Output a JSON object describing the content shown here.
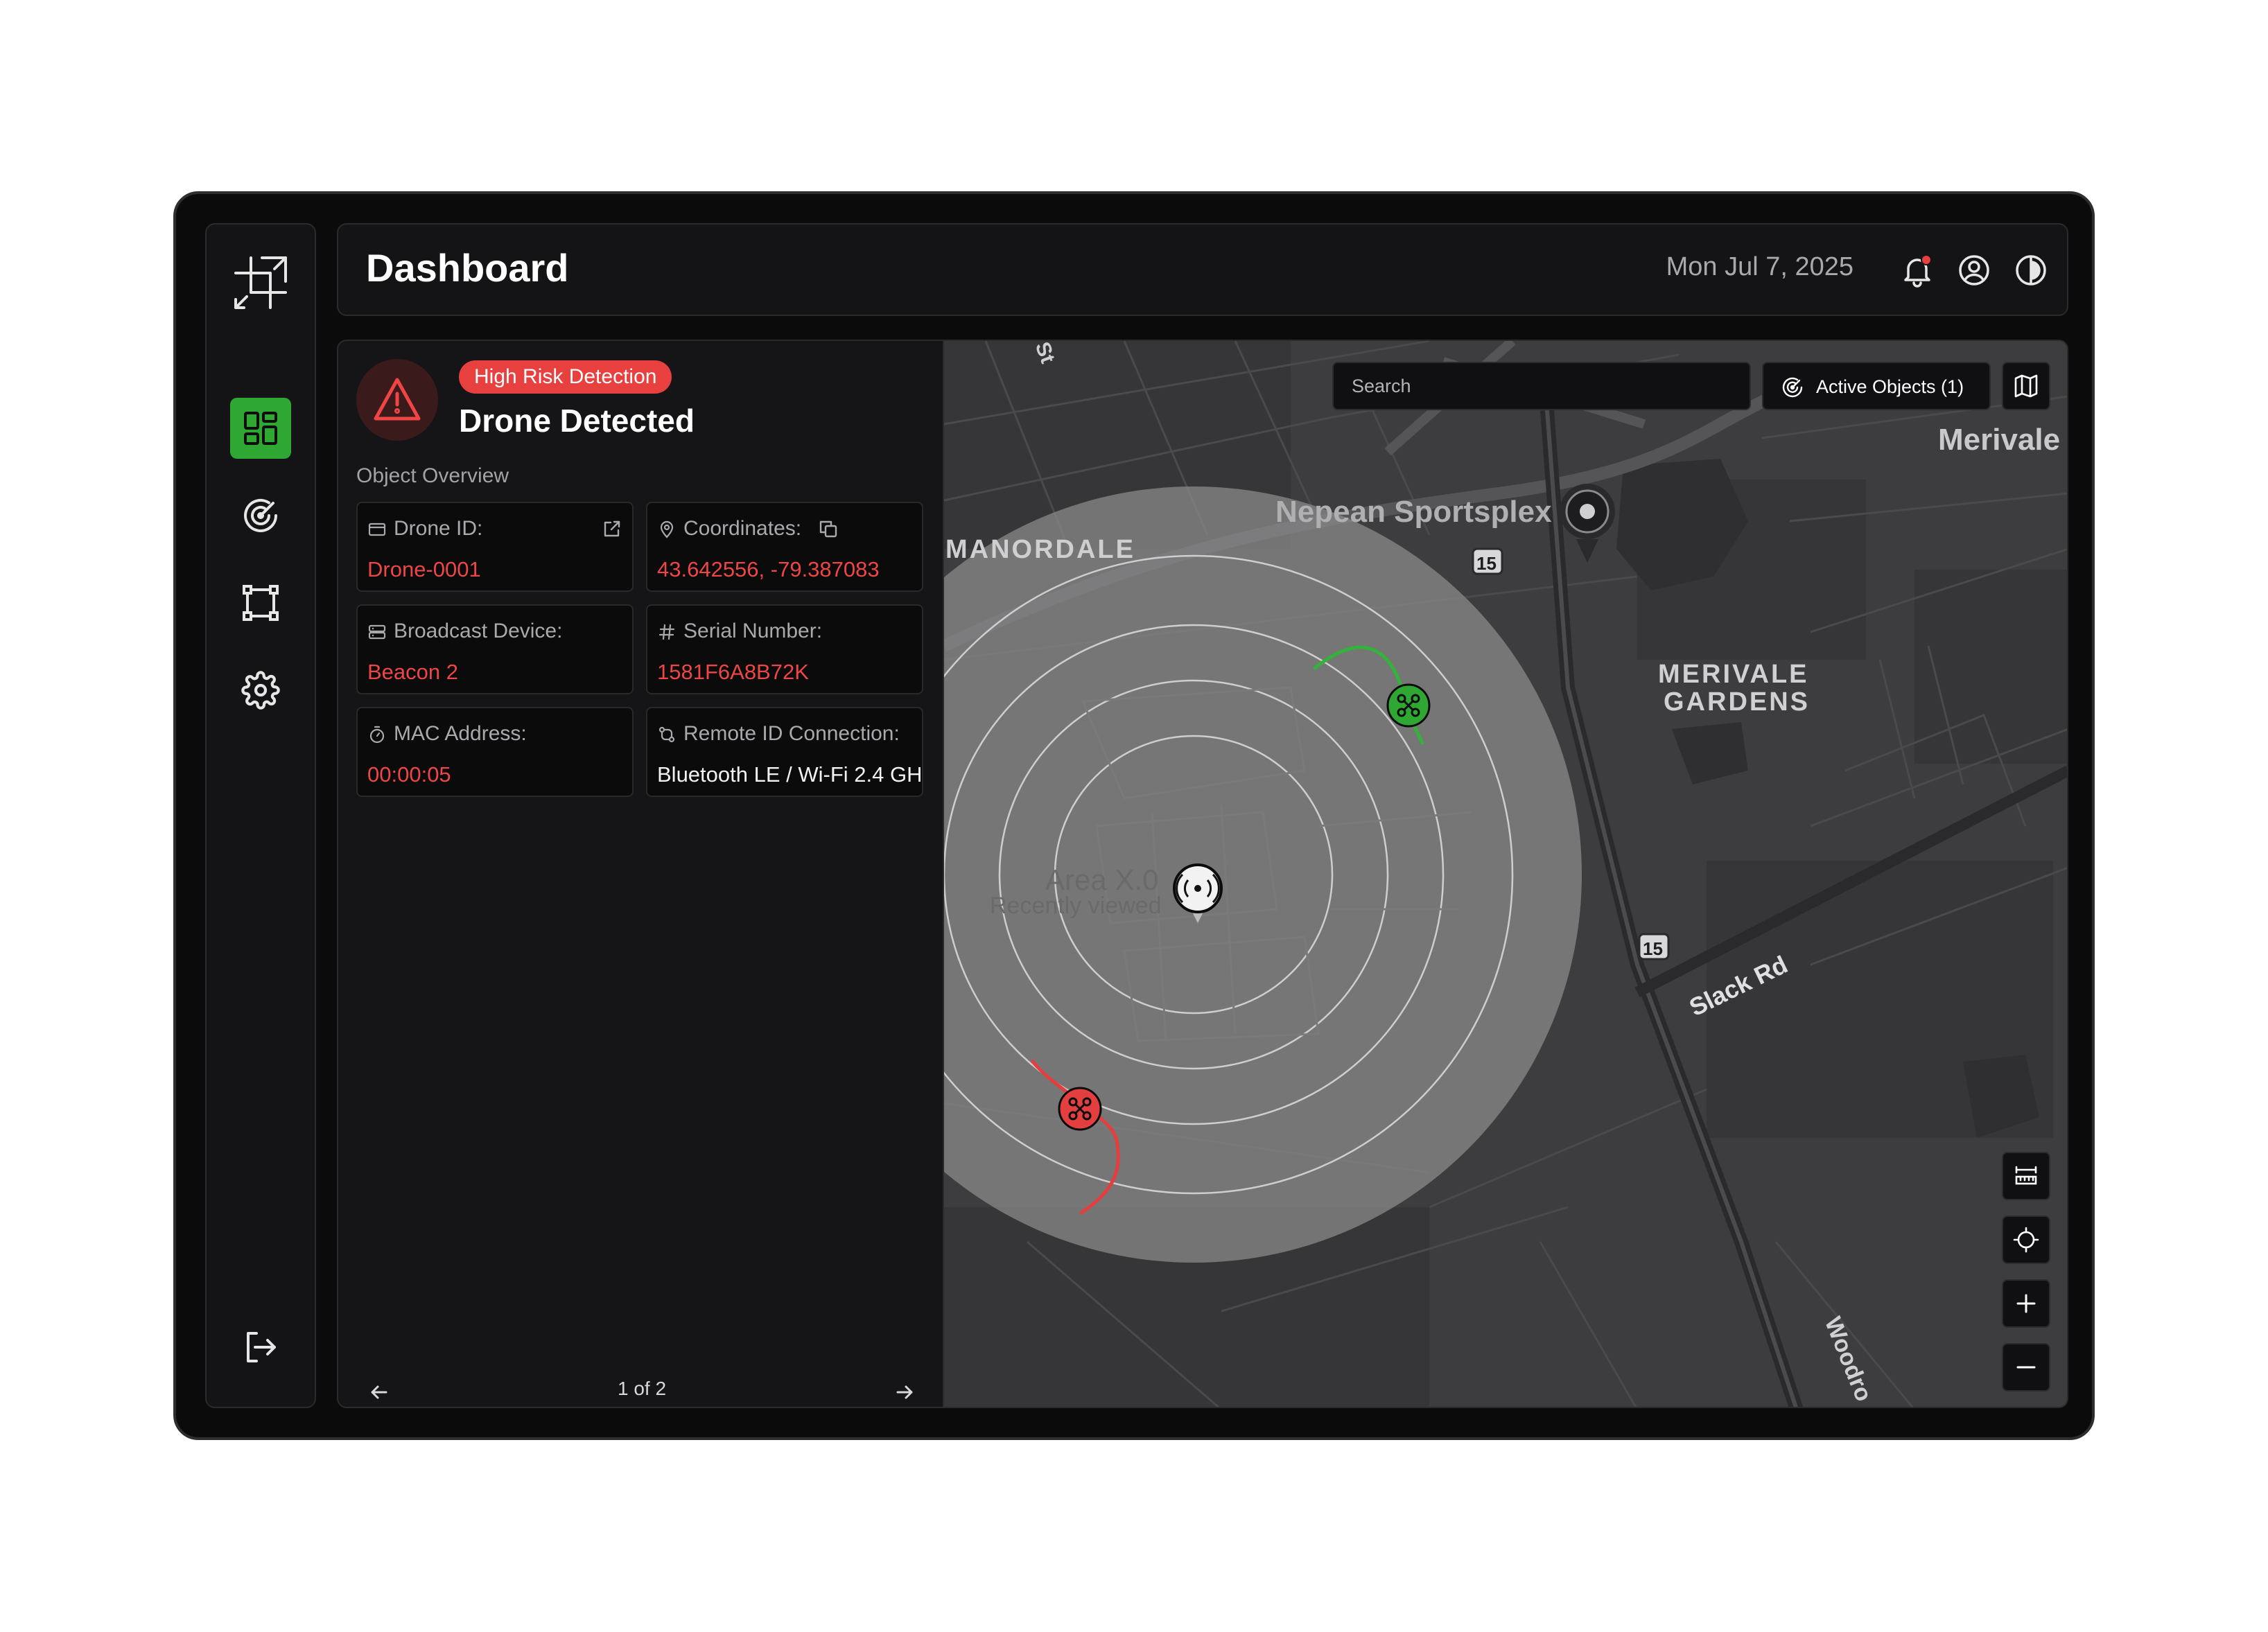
{
  "header": {
    "title": "Dashboard",
    "date": "Mon Jul 7, 2025"
  },
  "colors": {
    "accent_green": "#2fa833",
    "alert_red": "#e83f3f",
    "panel_bg": "#151517",
    "map_bg": "#3d3d3f"
  },
  "sidebar": {
    "logo_icon": "crop-logo-icon",
    "items": [
      {
        "icon": "dashboard-icon",
        "active": true
      },
      {
        "icon": "radar-icon",
        "active": false
      },
      {
        "icon": "bounding-box-icon",
        "active": false
      },
      {
        "icon": "gear-icon",
        "active": false
      }
    ],
    "logout_icon": "logout-icon"
  },
  "alert": {
    "badge": "High Risk Detection",
    "title": "Drone Detected",
    "section_label": "Object Overview",
    "fields": [
      {
        "label": "Drone ID:",
        "value": "Drone-0001",
        "icon": "id-card-icon",
        "action_icon": "external-link-icon"
      },
      {
        "label": "Coordinates:",
        "value": "43.642556, -79.387083",
        "icon": "location-pin-icon",
        "action_icon": "copy-icon"
      },
      {
        "label": "Broadcast Device:",
        "value": "Beacon 2",
        "icon": "server-icon"
      },
      {
        "label": "Serial Number:",
        "value": "1581F6A8B72K",
        "icon": "hash-icon"
      },
      {
        "label": "MAC Address:",
        "value": "00:00:05",
        "icon": "timer-icon"
      },
      {
        "label": "Remote ID Connection:",
        "value": "Bluetooth LE / Wi-Fi 2.4 GH",
        "icon": "connection-icon"
      }
    ],
    "pager": "1 of 2"
  },
  "map": {
    "search_placeholder": "Search",
    "active_objects_label": "Active Objects (1)",
    "labels": {
      "merivale_e": "Merivale E",
      "nepean": "Nepean Sportsplex",
      "manordale": "MANORDALE",
      "merivale_gardens_1": "MERIVALE",
      "merivale_gardens_2": "GARDENS",
      "area": "Area X.0",
      "recently_viewed": "Recently viewed",
      "slack_rd": "Slack Rd",
      "woodroffe": "Woodro",
      "route_1": "15",
      "route_2": "15",
      "street_top": "St"
    }
  }
}
